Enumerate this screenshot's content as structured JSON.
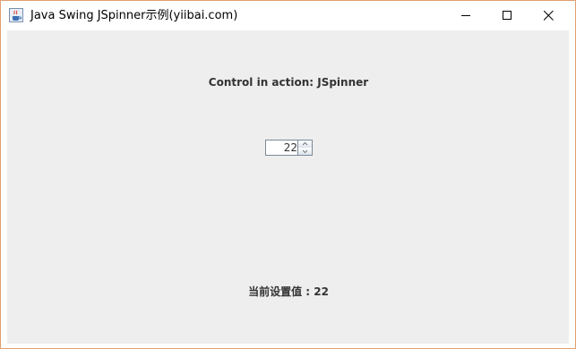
{
  "window": {
    "title": "Java Swing JSpinner示例(yiibai.com)",
    "app_icon": "java-cup-icon",
    "controls": {
      "minimize": "minimize-icon",
      "maximize": "maximize-icon",
      "close": "close-icon"
    }
  },
  "main": {
    "header": "Control in action: JSpinner",
    "spinner": {
      "value": "22",
      "up_icon": "chevron-up-icon",
      "down_icon": "chevron-down-icon"
    },
    "status": "当前设置值 : 22"
  },
  "colors": {
    "window_border": "#e0a070",
    "content_bg": "#eeeeee",
    "label_text": "#333333"
  }
}
